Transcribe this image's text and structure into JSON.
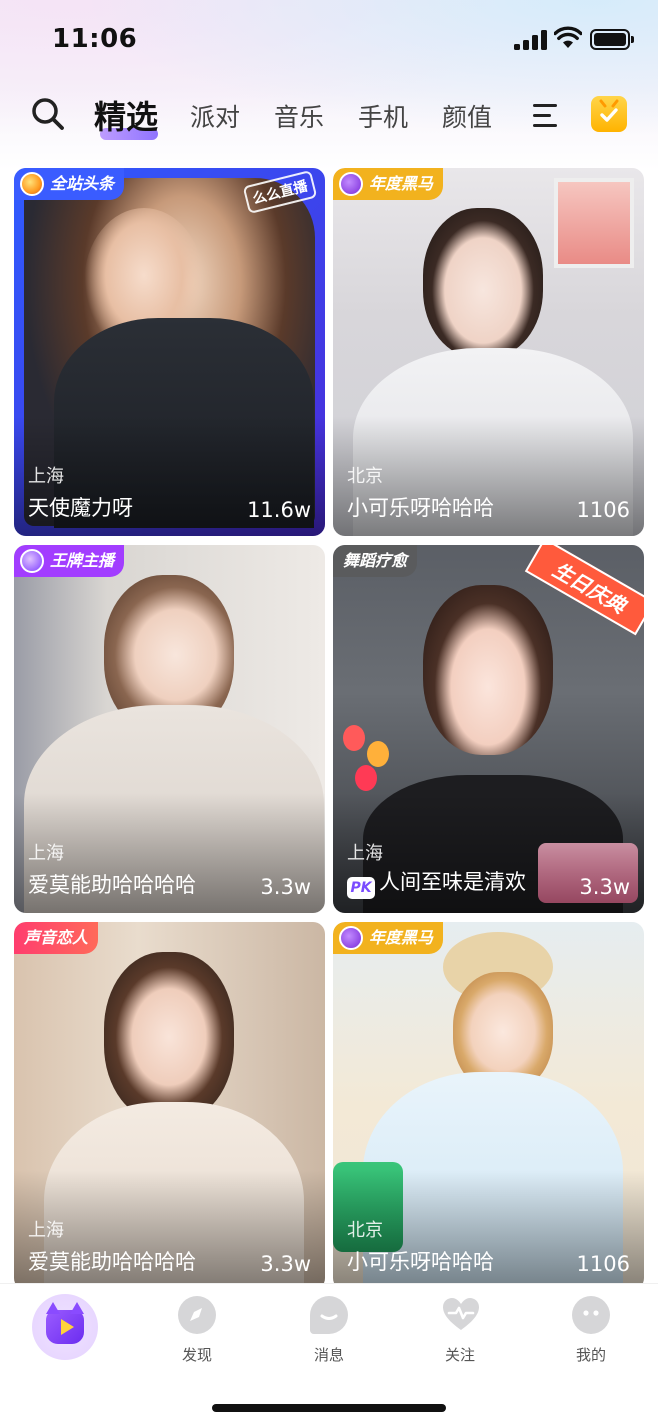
{
  "status_bar": {
    "time": "11:06"
  },
  "top_nav": {
    "tabs": [
      {
        "label": "精选",
        "active": true
      },
      {
        "label": "派对",
        "active": false
      },
      {
        "label": "音乐",
        "active": false
      },
      {
        "label": "手机",
        "active": false
      },
      {
        "label": "颜值",
        "active": false
      }
    ],
    "icons": [
      "search-icon",
      "menu-icon",
      "gift-icon"
    ]
  },
  "cards": [
    {
      "badge": "全站头条",
      "badge_color": "#3a5cff",
      "brand": "么么直播",
      "city": "上海",
      "name": "天使魔力呀",
      "count": "11.6w"
    },
    {
      "badge": "年度黑马",
      "badge_color": "#f2b21e",
      "city": "北京",
      "name": "小可乐呀哈哈哈",
      "count": "1106"
    },
    {
      "badge": "王牌主播",
      "badge_color": "#a23dff",
      "city": "上海",
      "name": "爱莫能助哈哈哈哈",
      "count": "3.3w"
    },
    {
      "badge": "舞蹈疗愈",
      "badge_color": "#7a7a7a",
      "promo": "生日庆典",
      "city": "上海",
      "name": "人间至味是清欢",
      "pk": "PK",
      "count": "3.3w"
    },
    {
      "badge": "声音恋人",
      "badge_color": "#ff3d6e",
      "city": "上海",
      "name": "爱莫能助哈哈哈哈",
      "count": "3.3w"
    },
    {
      "badge": "年度黑马",
      "badge_color": "#f2b21e",
      "city": "北京",
      "name": "小可乐呀哈哈哈",
      "count": "1106"
    }
  ],
  "bottom_nav": {
    "items": [
      {
        "label": ""
      },
      {
        "label": "发现"
      },
      {
        "label": "消息"
      },
      {
        "label": "关注"
      },
      {
        "label": "我的"
      }
    ]
  }
}
